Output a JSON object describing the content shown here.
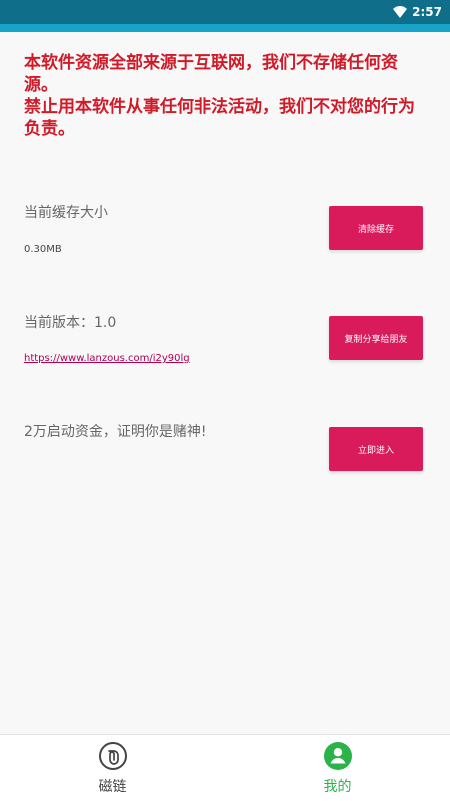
{
  "status_bar": {
    "time": "2:57",
    "icons": [
      "wifi-icon"
    ]
  },
  "disclaimer": {
    "text": "本软件资源全部来源于互联网，我们不存储任何资源。\n禁止用本软件从事任何非法活动，我们不对您的行为负责。"
  },
  "settings": {
    "cache": {
      "title": "当前缓存大小",
      "value": "0.30MB",
      "button": "清除缓存"
    },
    "version": {
      "title": "当前版本：1.0",
      "link": "https://www.lanzous.com/i2y90lg",
      "button": "复制分享给朋友"
    },
    "promo": {
      "title": "2万启动资金，证明你是赌神!",
      "button": "立即进入"
    }
  },
  "bottom_nav": {
    "items": [
      {
        "label": "磁链",
        "icon": "link-icon",
        "active": false
      },
      {
        "label": "我的",
        "icon": "user-icon",
        "active": true
      }
    ]
  },
  "colors": {
    "status_bar": "#0f6f8a",
    "accent_blue": "#17a4c8",
    "primary": "#d91b5c",
    "warning_text": "#d11a28",
    "active_nav": "#2bb34a",
    "inactive_nav": "#444444"
  }
}
